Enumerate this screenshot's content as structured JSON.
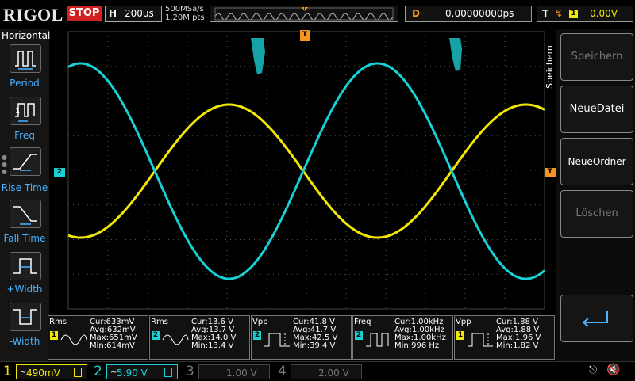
{
  "header": {
    "logo": "RIGOL",
    "run_state": "STOP",
    "timebase_label": "H",
    "timebase_value": "200us",
    "sample_rate": "500MSa/s",
    "memory_depth": "1.20M pts",
    "trig_marker": "T",
    "delay_label": "D",
    "delay_value": "0.00000000ps",
    "trigger_label": "T",
    "trigger_channel": "1",
    "trigger_level": "0.00V"
  },
  "left_panel": {
    "title": "Horizontal",
    "buttons": [
      {
        "label": "Period"
      },
      {
        "label": "Freq"
      },
      {
        "label": "Rise Time"
      },
      {
        "label": "Fall Time"
      },
      {
        "label": "+Width"
      },
      {
        "label": "-Width"
      }
    ]
  },
  "right_panel": {
    "side_title": "Speichern",
    "buttons": [
      {
        "label": "Speichern",
        "enabled": false
      },
      {
        "label": "NeueDatei",
        "enabled": true
      },
      {
        "label": "NeueOrdner",
        "enabled": true
      },
      {
        "label": "Löschen",
        "enabled": false
      },
      {
        "label": "",
        "enabled": true
      }
    ]
  },
  "markers": {
    "ch2_level": "2",
    "trigger_pos": "T",
    "trigger_level": "T"
  },
  "measurements": [
    {
      "name": "Rms",
      "channel": "1",
      "color": "#f2e700",
      "cur": "Cur:633mV",
      "avg": "Avg:632mV",
      "max": "Max:651mV",
      "min": "Min:614mV"
    },
    {
      "name": "Rms",
      "channel": "2",
      "color": "#16d2d4",
      "cur": "Cur:13.6 V",
      "avg": "Avg:13.7 V",
      "max": "Max:14.0 V",
      "min": "Min:13.4 V"
    },
    {
      "name": "Vpp",
      "channel": "2",
      "color": "#16d2d4",
      "cur": "Cur:41.8 V",
      "avg": "Avg:41.7 V",
      "max": "Max:42.5 V",
      "min": "Min:39.4 V"
    },
    {
      "name": "Freq",
      "channel": "2",
      "color": "#16d2d4",
      "cur": "Cur:1.00kHz",
      "avg": "Avg:1.00kHz",
      "max": "Max:1.00kHz",
      "min": "Min:996 Hz"
    },
    {
      "name": "Vpp",
      "channel": "1",
      "color": "#f2e700",
      "cur": "Cur:1.88 V",
      "avg": "Avg:1.88 V",
      "max": "Max:1.96 V",
      "min": "Min:1.82 V"
    }
  ],
  "channels": [
    {
      "num": "1",
      "value": "490mV",
      "color": "#f2e700",
      "active": true
    },
    {
      "num": "2",
      "value": "5.90 V",
      "color": "#16d2d4",
      "active": true
    },
    {
      "num": "3",
      "value": "1.00 V",
      "color": "#777777",
      "active": false
    },
    {
      "num": "4",
      "value": "2.00 V",
      "color": "#777777",
      "active": false
    }
  ],
  "colors": {
    "ch1": "#f2e700",
    "ch2": "#16d2d4",
    "trigger": "#f7941d",
    "accent": "#4ab2ff"
  }
}
